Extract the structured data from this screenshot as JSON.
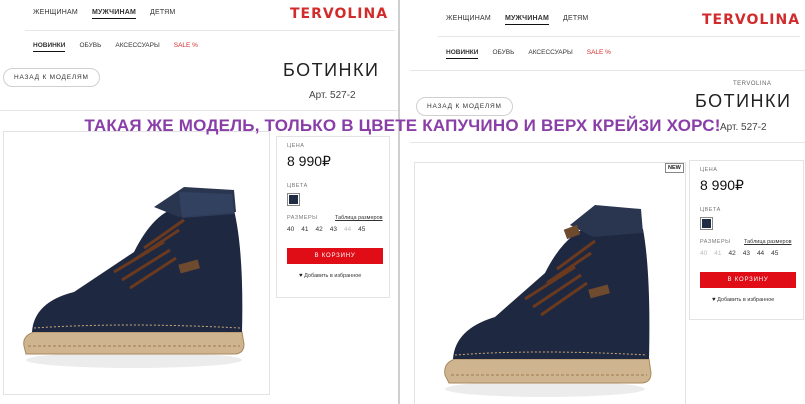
{
  "brand": "TERVOLINA",
  "nav_top": [
    "ЖЕНЩИНАМ",
    "МУЖЧИНАМ",
    "ДЕТЯМ"
  ],
  "nav_sub": [
    "НОВИНКИ",
    "ОБУВЬ",
    "АКСЕССУАРЫ",
    "SALE %"
  ],
  "back_label": "НАЗАД К МОДЕЛЯМ",
  "headline": "ТАКАЯ ЖЕ МОДЕЛЬ, ТОЛЬКО В ЦВЕТЕ КАПУЧИНО И ВЕРХ КРЕЙЗИ ХОРС!",
  "left": {
    "title": "БОТИНКИ",
    "article": "Арт. 527-2",
    "price_label": "ЦЕНА",
    "price": "8 990",
    "currency": "₽",
    "colors_label": "ЦВЕТА",
    "sizes_label": "РАЗМЕРЫ",
    "size_table": "Таблица размеров",
    "sizes": [
      {
        "v": "40",
        "available": true
      },
      {
        "v": "41",
        "available": true
      },
      {
        "v": "42",
        "available": true
      },
      {
        "v": "43",
        "available": true
      },
      {
        "v": "44",
        "available": false
      },
      {
        "v": "45",
        "available": true
      }
    ],
    "cart": "В КОРЗИНУ",
    "favorite": "Добавить в избранное",
    "swatch_color": "#1f2c44"
  },
  "right": {
    "brand_small": "TERVOLINA",
    "title": "БОТИНКИ",
    "article": "Арт. 527-2",
    "badge": "NEW",
    "price_label": "ЦЕНА",
    "price": "8 990",
    "currency": "₽",
    "colors_label": "ЦВЕТА",
    "sizes_label": "РАЗМЕРЫ",
    "size_table": "Таблица размеров",
    "sizes": [
      {
        "v": "40",
        "available": false
      },
      {
        "v": "41",
        "available": false
      },
      {
        "v": "42",
        "available": true
      },
      {
        "v": "43",
        "available": true
      },
      {
        "v": "44",
        "available": true
      },
      {
        "v": "45",
        "available": true
      }
    ],
    "cart": "В КОРЗИНУ",
    "favorite": "Добавить в избранное",
    "swatch_color": "#1f2c44"
  },
  "colors": {
    "accent": "#e00d16",
    "logo": "#d12b2b",
    "headline": "#8a3fa8"
  }
}
